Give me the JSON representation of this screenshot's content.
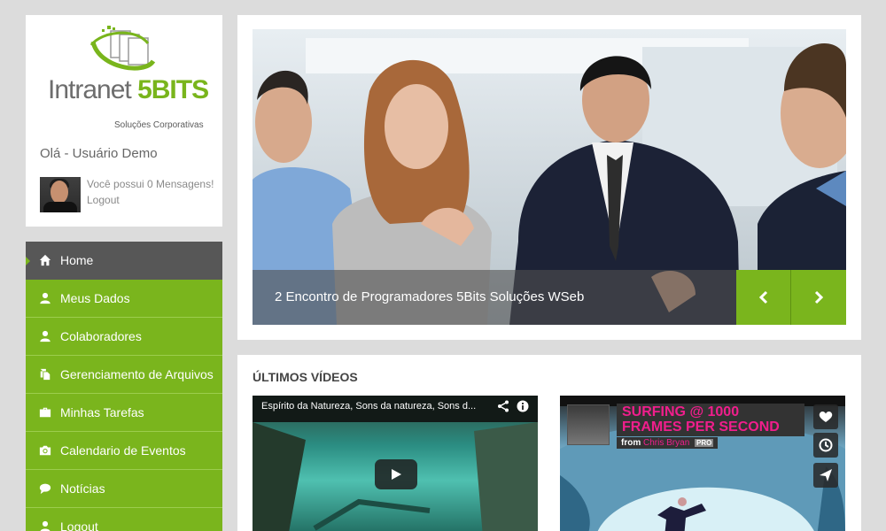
{
  "brand": {
    "name_part1": "Intranet ",
    "name_part2": "5BITS",
    "tagline": "Soluções Corporativas",
    "accent_color": "#7ab51d",
    "logo_icon": "documents-orbit-icon"
  },
  "user": {
    "greeting": "Olá - Usuário Demo",
    "messages": "Você possui 0 Mensagens!",
    "logout": "Logout"
  },
  "menu": {
    "items": [
      {
        "label": "Home",
        "icon": "home-icon",
        "active": true
      },
      {
        "label": "Meus Dados",
        "icon": "user-icon"
      },
      {
        "label": "Colaboradores",
        "icon": "user-icon"
      },
      {
        "label": "Gerenciamento de Arquivos",
        "icon": "files-icon"
      },
      {
        "label": "Minhas Tarefas",
        "icon": "briefcase-icon"
      },
      {
        "label": "Calendario de Eventos",
        "icon": "camera-icon"
      },
      {
        "label": "Notícias",
        "icon": "comment-icon"
      },
      {
        "label": "Logout",
        "icon": "user-icon"
      }
    ]
  },
  "slider": {
    "caption": "2 Encontro de Programadores 5Bits Soluções WSeb",
    "prev_icon": "chevron-left-icon",
    "next_icon": "chevron-right-icon"
  },
  "videos": {
    "title": "ÚLTIMOS VÍDEOS",
    "items": [
      {
        "title": "Espírito da Natureza, Sons da natureza, Sons d...",
        "icons": [
          "share-icon",
          "info-icon",
          "play-icon"
        ]
      },
      {
        "title_line1": "SURFING @ 1000",
        "title_line2": "FRAMES PER SECOND",
        "from": "from",
        "author": "Chris Bryan",
        "badge": "PRO",
        "icons": [
          "heart-icon",
          "clock-icon",
          "send-icon"
        ]
      }
    ]
  }
}
